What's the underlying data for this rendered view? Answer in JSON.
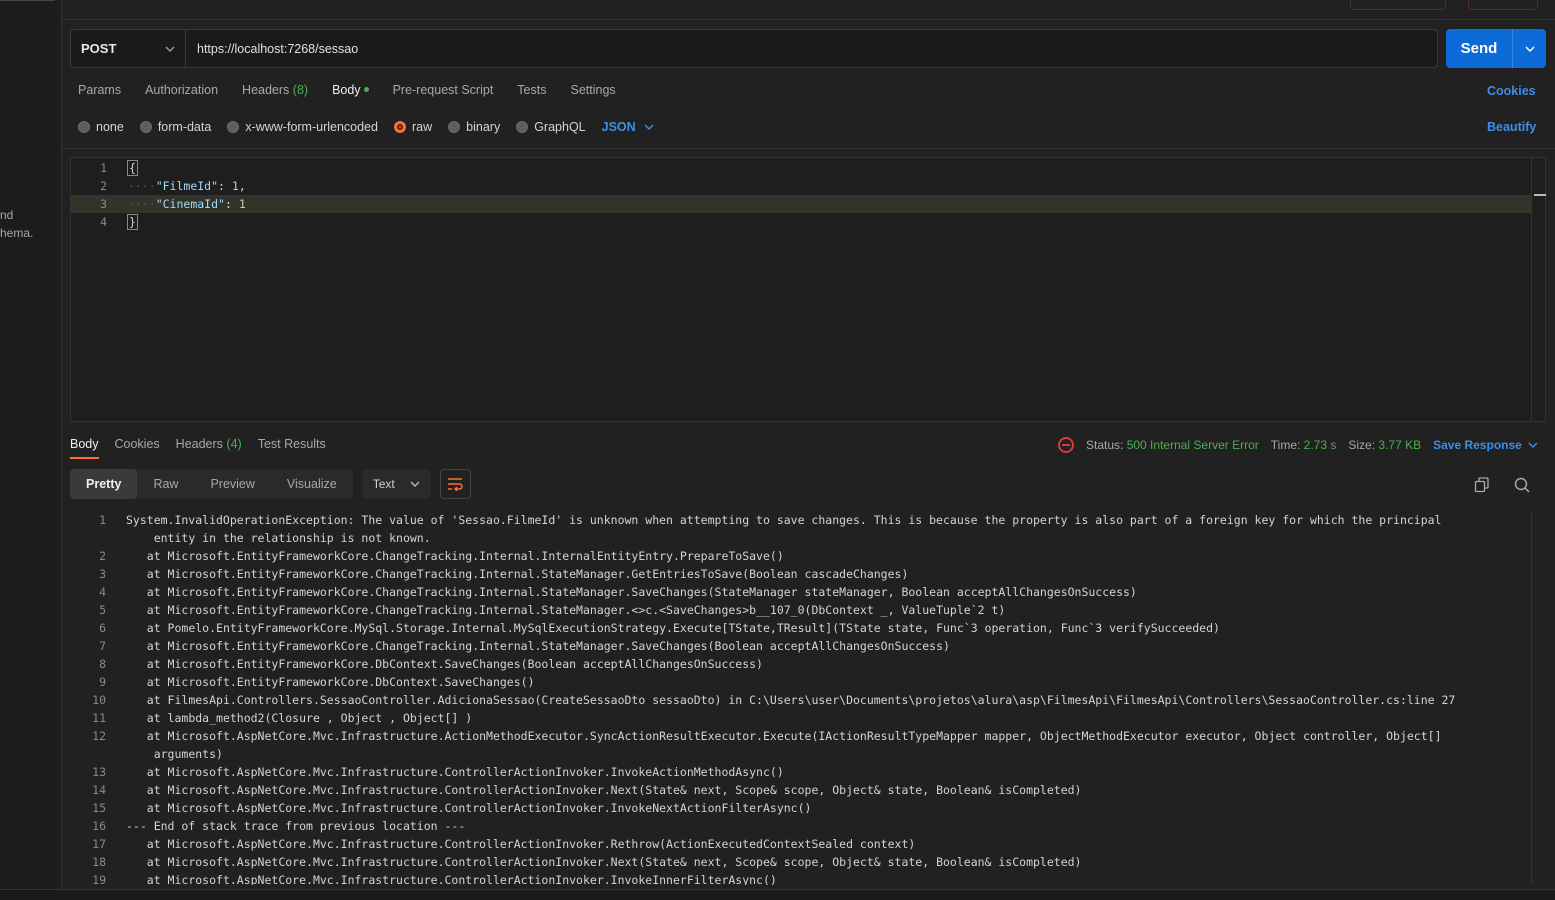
{
  "sidebar": {
    "fragment_1": "nd",
    "fragment_2": "hema."
  },
  "request": {
    "method": "POST",
    "url": "https://localhost:7268/sessao",
    "send_label": "Send"
  },
  "req_tabs": {
    "params": "Params",
    "authorization": "Authorization",
    "headers": "Headers",
    "headers_count": "(8)",
    "body": "Body",
    "prerequest": "Pre-request Script",
    "tests": "Tests",
    "settings": "Settings",
    "cookies": "Cookies"
  },
  "body_types": {
    "none": "none",
    "form_data": "form-data",
    "urlencoded": "x-www-form-urlencoded",
    "raw": "raw",
    "binary": "binary",
    "graphql": "GraphQL",
    "format": "JSON",
    "beautify": "Beautify",
    "selected": "raw"
  },
  "editor": {
    "lines": [
      {
        "n": "1",
        "open": "{"
      },
      {
        "n": "2",
        "key": "\"FilmeId\"",
        "sep": ": ",
        "val": "1",
        "tail": ","
      },
      {
        "n": "3",
        "key": "\"CinemaId\"",
        "sep": ": ",
        "val": "1",
        "tail": ""
      },
      {
        "n": "4",
        "close": "}"
      }
    ]
  },
  "response": {
    "tabs": {
      "body": "Body",
      "cookies": "Cookies",
      "headers": "Headers",
      "headers_count": "(4)",
      "tests": "Test Results"
    },
    "status_label": "Status:",
    "status_value": "500 Internal Server Error",
    "time_label": "Time:",
    "time_value": "2.73 s",
    "size_label": "Size:",
    "size_value": "3.77 KB",
    "save_label": "Save Response",
    "view_modes": {
      "pretty": "Pretty",
      "raw": "Raw",
      "preview": "Preview",
      "visualize": "Visualize"
    },
    "text_format": "Text",
    "lines": [
      {
        "n": "1",
        "text": "System.InvalidOperationException: The value of 'Sessao.FilmeId' is unknown when attempting to save changes. This is because the property is also part of a foreign key for which the principal\n    entity in the relationship is not known."
      },
      {
        "n": "2",
        "text": "   at Microsoft.EntityFrameworkCore.ChangeTracking.Internal.InternalEntityEntry.PrepareToSave()"
      },
      {
        "n": "3",
        "text": "   at Microsoft.EntityFrameworkCore.ChangeTracking.Internal.StateManager.GetEntriesToSave(Boolean cascadeChanges)"
      },
      {
        "n": "4",
        "text": "   at Microsoft.EntityFrameworkCore.ChangeTracking.Internal.StateManager.SaveChanges(StateManager stateManager, Boolean acceptAllChangesOnSuccess)"
      },
      {
        "n": "5",
        "text": "   at Microsoft.EntityFrameworkCore.ChangeTracking.Internal.StateManager.<>c.<SaveChanges>b__107_0(DbContext _, ValueTuple`2 t)"
      },
      {
        "n": "6",
        "text": "   at Pomelo.EntityFrameworkCore.MySql.Storage.Internal.MySqlExecutionStrategy.Execute[TState,TResult](TState state, Func`3 operation, Func`3 verifySucceeded)"
      },
      {
        "n": "7",
        "text": "   at Microsoft.EntityFrameworkCore.ChangeTracking.Internal.StateManager.SaveChanges(Boolean acceptAllChangesOnSuccess)"
      },
      {
        "n": "8",
        "text": "   at Microsoft.EntityFrameworkCore.DbContext.SaveChanges(Boolean acceptAllChangesOnSuccess)"
      },
      {
        "n": "9",
        "text": "   at Microsoft.EntityFrameworkCore.DbContext.SaveChanges()"
      },
      {
        "n": "10",
        "text": "   at FilmesApi.Controllers.SessaoController.AdicionaSessao(CreateSessaoDto sessaoDto) in C:\\Users\\user\\Documents\\projetos\\alura\\asp\\FilmesApi\\FilmesApi\\Controllers\\SessaoController.cs:line 27"
      },
      {
        "n": "11",
        "text": "   at lambda_method2(Closure , Object , Object[] )"
      },
      {
        "n": "12",
        "text": "   at Microsoft.AspNetCore.Mvc.Infrastructure.ActionMethodExecutor.SyncActionResultExecutor.Execute(IActionResultTypeMapper mapper, ObjectMethodExecutor executor, Object controller, Object[]\n    arguments)"
      },
      {
        "n": "13",
        "text": "   at Microsoft.AspNetCore.Mvc.Infrastructure.ControllerActionInvoker.InvokeActionMethodAsync()"
      },
      {
        "n": "14",
        "text": "   at Microsoft.AspNetCore.Mvc.Infrastructure.ControllerActionInvoker.Next(State& next, Scope& scope, Object& state, Boolean& isCompleted)"
      },
      {
        "n": "15",
        "text": "   at Microsoft.AspNetCore.Mvc.Infrastructure.ControllerActionInvoker.InvokeNextActionFilterAsync()"
      },
      {
        "n": "16",
        "text": "--- End of stack trace from previous location ---"
      },
      {
        "n": "17",
        "text": "   at Microsoft.AspNetCore.Mvc.Infrastructure.ControllerActionInvoker.Rethrow(ActionExecutedContextSealed context)"
      },
      {
        "n": "18",
        "text": "   at Microsoft.AspNetCore.Mvc.Infrastructure.ControllerActionInvoker.Next(State& next, Scope& scope, Object& state, Boolean& isCompleted)"
      },
      {
        "n": "19",
        "text": "   at Microsoft.AspNetCore.Mvc.Infrastructure.ControllerActionInvoker.InvokeInnerFilterAsync()"
      }
    ]
  },
  "colors": {
    "accent_blue": "#0c6bd6",
    "accent_orange": "#ff6c37",
    "success_green": "#4caf50",
    "error_red": "#d83a3a"
  }
}
